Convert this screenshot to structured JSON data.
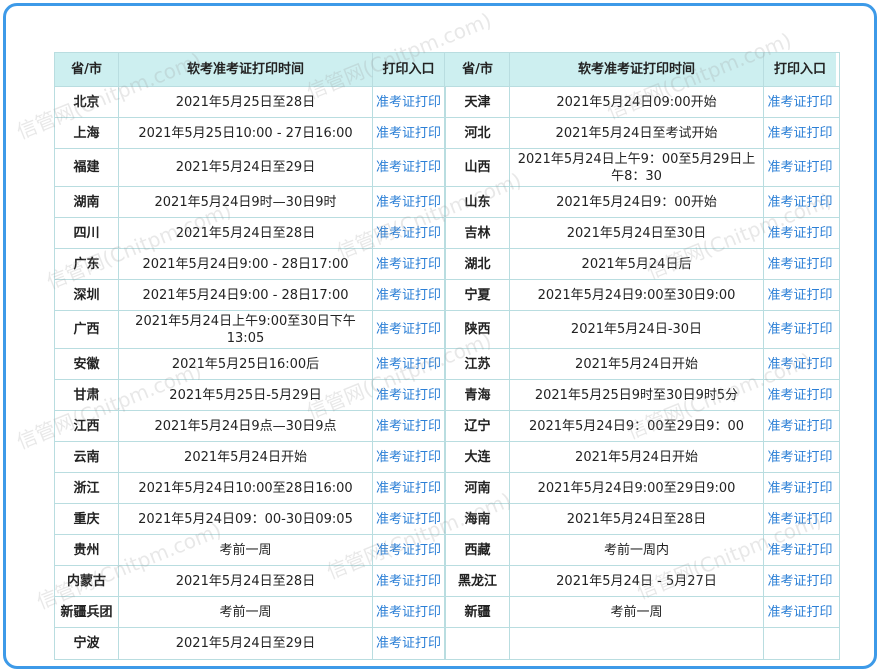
{
  "header": {
    "col_prov": "省/市",
    "col_time": "软考准考证打印时间",
    "col_link": "打印入口"
  },
  "rows": [
    {
      "left": {
        "prov": "北京",
        "time": "2021年5月25日至28日",
        "link": "准考证打印"
      },
      "right": {
        "prov": "天津",
        "time": "2021年5月24日09:00开始",
        "link": "准考证打印"
      }
    },
    {
      "left": {
        "prov": "上海",
        "time": "2021年5月25日10:00 - 27日16:00",
        "link": "准考证打印"
      },
      "right": {
        "prov": "河北",
        "time": "2021年5月24日至考试开始",
        "link": "准考证打印"
      }
    },
    {
      "left": {
        "prov": "福建",
        "time": "2021年5月24日至29日",
        "link": "准考证打印"
      },
      "right": {
        "prov": "山西",
        "time": "2021年5月24日上午9：00至5月29日上午8：30",
        "link": "准考证打印"
      }
    },
    {
      "left": {
        "prov": "湖南",
        "time": "2021年5月24日9时—30日9时",
        "link": "准考证打印"
      },
      "right": {
        "prov": "山东",
        "time": "2021年5月24日9：00开始",
        "link": "准考证打印"
      }
    },
    {
      "left": {
        "prov": "四川",
        "time": "2021年5月24日至28日",
        "link": "准考证打印"
      },
      "right": {
        "prov": "吉林",
        "time": "2021年5月24日至30日",
        "link": "准考证打印"
      }
    },
    {
      "left": {
        "prov": "广东",
        "time": "2021年5月24日9:00 - 28日17:00",
        "link": "准考证打印"
      },
      "right": {
        "prov": "湖北",
        "time": "2021年5月24日后",
        "link": "准考证打印"
      }
    },
    {
      "left": {
        "prov": "深圳",
        "time": "2021年5月24日9:00 - 28日17:00",
        "link": "准考证打印"
      },
      "right": {
        "prov": "宁夏",
        "time": "2021年5月24日9:00至30日9:00",
        "link": "准考证打印"
      }
    },
    {
      "left": {
        "prov": "广西",
        "time": "2021年5月24日上午9:00至30日下午13:05",
        "link": "准考证打印"
      },
      "right": {
        "prov": "陕西",
        "time": "2021年5月24日-30日",
        "link": "准考证打印"
      }
    },
    {
      "left": {
        "prov": "安徽",
        "time": "2021年5月25日16:00后",
        "link": "准考证打印"
      },
      "right": {
        "prov": "江苏",
        "time": "2021年5月24日开始",
        "link": "准考证打印"
      }
    },
    {
      "left": {
        "prov": "甘肃",
        "time": "2021年5月25日-5月29日",
        "link": "准考证打印"
      },
      "right": {
        "prov": "青海",
        "time": "2021年5月25日9时至30日9时5分",
        "link": "准考证打印"
      }
    },
    {
      "left": {
        "prov": "江西",
        "time": "2021年5月24日9点—30日9点",
        "link": "准考证打印"
      },
      "right": {
        "prov": "辽宁",
        "time": "2021年5月24日9：00至29日9：00",
        "link": "准考证打印"
      }
    },
    {
      "left": {
        "prov": "云南",
        "time": "2021年5月24日开始",
        "link": "准考证打印"
      },
      "right": {
        "prov": "大连",
        "time": "2021年5月24日开始",
        "link": "准考证打印"
      }
    },
    {
      "left": {
        "prov": "浙江",
        "time": "2021年5月24日10:00至28日16:00",
        "link": "准考证打印"
      },
      "right": {
        "prov": "河南",
        "time": "2021年5月24日9:00至29日9:00",
        "link": "准考证打印"
      }
    },
    {
      "left": {
        "prov": "重庆",
        "time": "2021年5月24日09：00-30日09:05",
        "link": "准考证打印"
      },
      "right": {
        "prov": "海南",
        "time": "2021年5月24日至28日",
        "link": "准考证打印"
      }
    },
    {
      "left": {
        "prov": "贵州",
        "time": "考前一周",
        "link": "准考证打印"
      },
      "right": {
        "prov": "西藏",
        "time": "考前一周内",
        "link": "准考证打印"
      }
    },
    {
      "left": {
        "prov": "内蒙古",
        "time": "2021年5月24日至28日",
        "link": "准考证打印"
      },
      "right": {
        "prov": "黑龙江",
        "time": "2021年5月24日 - 5月27日",
        "link": "准考证打印"
      }
    },
    {
      "left": {
        "prov": "新疆兵团",
        "time": "考前一周",
        "link": "准考证打印"
      },
      "right": {
        "prov": "新疆",
        "time": "考前一周",
        "link": "准考证打印"
      }
    },
    {
      "left": {
        "prov": "宁波",
        "time": "2021年5月24日至29日",
        "link": "准考证打印"
      },
      "right": {
        "prov": "",
        "time": "",
        "link": ""
      }
    }
  ],
  "watermark": "信管网(Cnitpm.com)"
}
